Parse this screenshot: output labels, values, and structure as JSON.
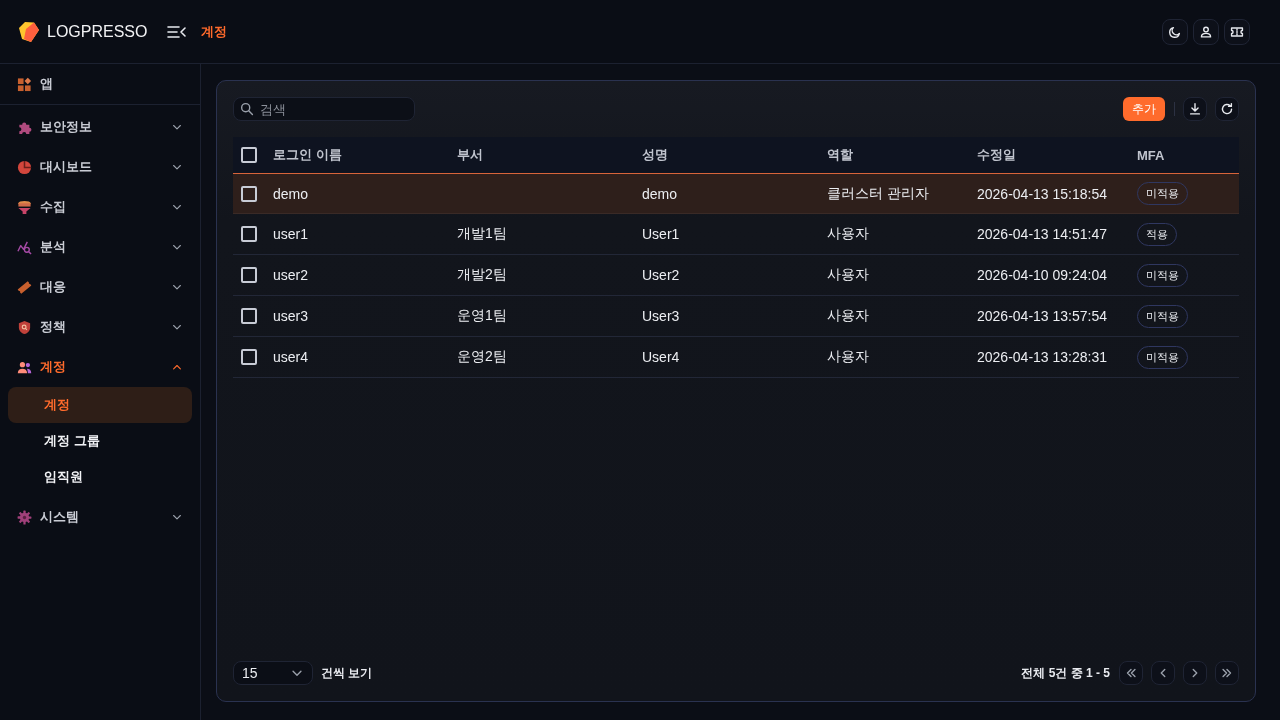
{
  "header": {
    "brand": "LOGPRESSO",
    "breadcrumb": "계정"
  },
  "sidebar": {
    "app_link": {
      "label": "앱"
    },
    "groups": [
      {
        "label": "보안정보",
        "selected": false,
        "expanded": false
      },
      {
        "label": "대시보드",
        "selected": false,
        "expanded": false
      },
      {
        "label": "수집",
        "selected": false,
        "expanded": false
      },
      {
        "label": "분석",
        "selected": false,
        "expanded": false
      },
      {
        "label": "대응",
        "selected": false,
        "expanded": false
      },
      {
        "label": "정책",
        "selected": false,
        "expanded": false
      },
      {
        "label": "계정",
        "selected": true,
        "expanded": true,
        "children": [
          {
            "label": "계정",
            "selected": true
          },
          {
            "label": "계정 그룹",
            "selected": false
          },
          {
            "label": "임직원",
            "selected": false
          }
        ]
      },
      {
        "label": "시스템",
        "selected": false,
        "expanded": false
      }
    ]
  },
  "toolbar": {
    "search": {
      "placeholder": "검색"
    },
    "add_button": "추가"
  },
  "table": {
    "select_all": {
      "checked": false
    },
    "columns": [
      "로그인 이름",
      "부서",
      "성명",
      "역할",
      "수정일",
      "MFA"
    ],
    "rows": [
      {
        "selected": true,
        "checked": false,
        "login_name": "demo",
        "full_name": "demo",
        "role": "클러스터 관리자",
        "modified": "2026-04-13 15:18:54",
        "mfa": "미적용"
      },
      {
        "selected": false,
        "checked": false,
        "login_name": "user1",
        "department": "개발1팀",
        "full_name": "User1",
        "role": "사용자",
        "modified": "2026-04-13 14:51:47",
        "mfa": "적용"
      },
      {
        "selected": false,
        "checked": false,
        "login_name": "user2",
        "department": "개발2팀",
        "full_name": "User2",
        "role": "사용자",
        "modified": "2026-04-10 09:24:04",
        "mfa": "미적용"
      },
      {
        "selected": false,
        "checked": false,
        "login_name": "user3",
        "department": "운영1팀",
        "full_name": "User3",
        "role": "사용자",
        "modified": "2026-04-13 13:57:54",
        "mfa": "미적용"
      },
      {
        "selected": false,
        "checked": false,
        "login_name": "user4",
        "department": "운영2팀",
        "full_name": "User4",
        "role": "사용자",
        "modified": "2026-04-13 13:28:31",
        "mfa": "미적용"
      }
    ]
  },
  "footer": {
    "page_size": "15",
    "page_size_label": "건씩 보기",
    "summary": "전체 5건 중 1 - 5"
  }
}
